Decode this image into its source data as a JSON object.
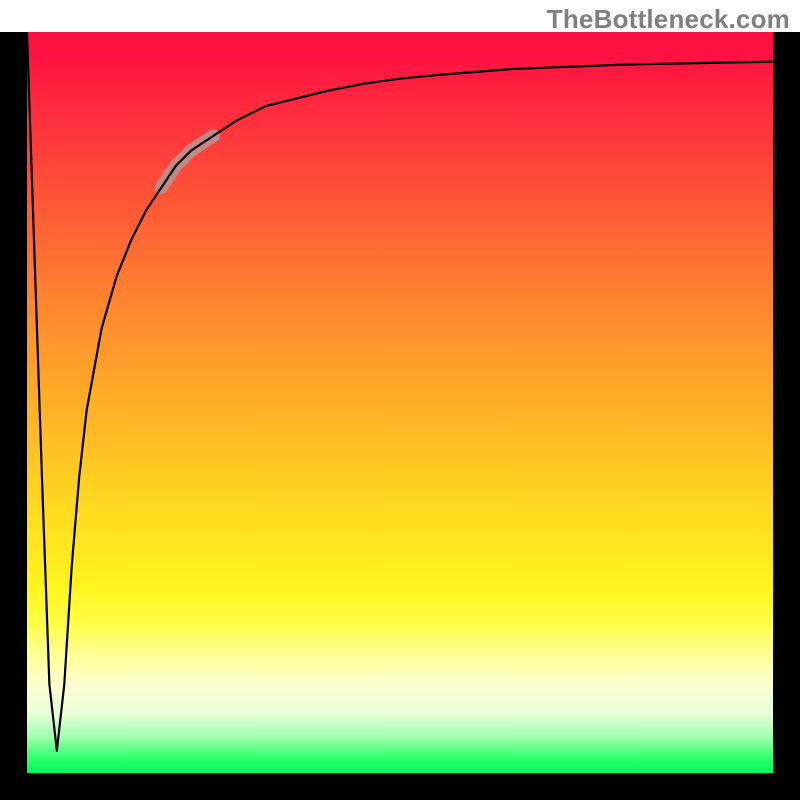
{
  "watermark": "TheBottleneck.com",
  "chart_data": {
    "type": "line",
    "title": "",
    "xlabel": "",
    "ylabel": "",
    "xlim": [
      0,
      100
    ],
    "ylim": [
      0,
      100
    ],
    "grid": false,
    "legend": false,
    "series": [
      {
        "name": "bottleneck-curve",
        "x": [
          0,
          1,
          2,
          3,
          4,
          5,
          6,
          7,
          8,
          10,
          12,
          14,
          16,
          18,
          20,
          22,
          25,
          28,
          32,
          36,
          40,
          45,
          50,
          55,
          60,
          65,
          70,
          75,
          80,
          85,
          90,
          95,
          100
        ],
        "y": [
          100,
          70,
          40,
          12,
          3,
          12,
          28,
          40,
          49,
          60,
          67,
          72,
          76,
          79,
          82,
          84,
          86,
          88,
          90,
          91,
          92,
          93,
          93.7,
          94.2,
          94.6,
          95,
          95.2,
          95.4,
          95.6,
          95.7,
          95.8,
          95.9,
          96
        ]
      }
    ],
    "annotations": [
      {
        "name": "highlight-segment",
        "x_range": [
          18,
          25
        ],
        "y_range": [
          79,
          86
        ],
        "color": "#c28787"
      }
    ],
    "background_gradient_stops": [
      {
        "pos": 0,
        "color": "#ff1142"
      },
      {
        "pos": 24,
        "color": "#ff5a36"
      },
      {
        "pos": 52,
        "color": "#ffb426"
      },
      {
        "pos": 75,
        "color": "#fff41e"
      },
      {
        "pos": 88,
        "color": "#fdffcf"
      },
      {
        "pos": 100,
        "color": "#00f95e"
      }
    ]
  }
}
